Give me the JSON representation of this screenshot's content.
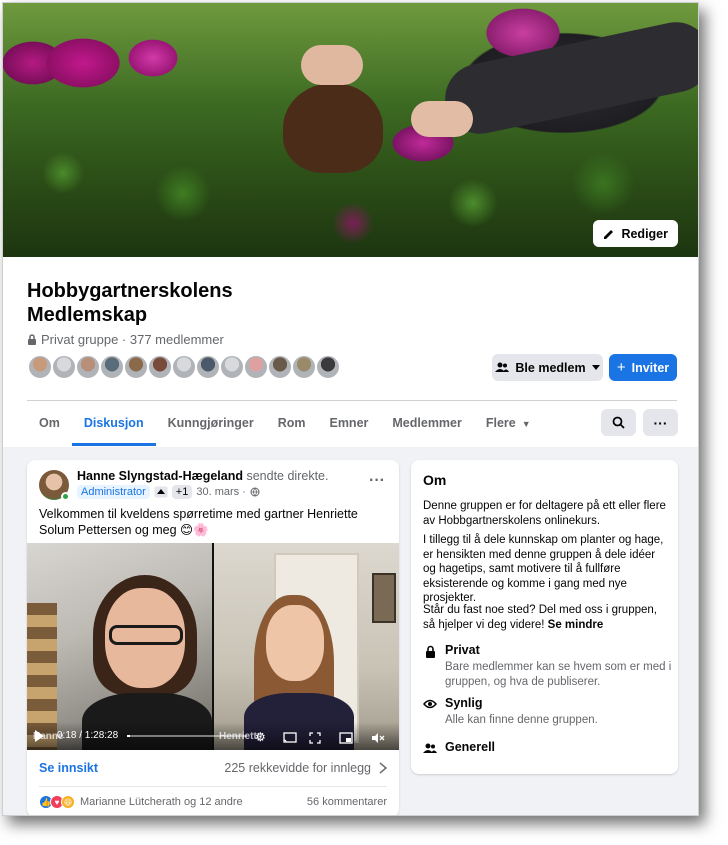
{
  "cover": {
    "edit_label": "Rediger"
  },
  "group": {
    "title": "Hobbygartnerskolens Medlemskap",
    "meta": "Privat gruppe · 377 medlemmer",
    "join_label": "Ble medlem",
    "invite_label": "Inviter",
    "member_avatars": [
      "#c89a7a",
      "#d7d9dc",
      "#b8907a",
      "#5a6b7a",
      "#8a6a4a",
      "#7a4a3a",
      "#d7d9dc",
      "#4a5a6a",
      "#d7d9dc",
      "#e0a0a0",
      "#6a5a4a",
      "#9a8a6a",
      "#3a3a3a"
    ]
  },
  "tabs": [
    {
      "label": "Om",
      "active": false
    },
    {
      "label": "Diskusjon",
      "active": true
    },
    {
      "label": "Kunngjøringer",
      "active": false
    },
    {
      "label": "Rom",
      "active": false
    },
    {
      "label": "Emner",
      "active": false
    },
    {
      "label": "Medlemmer",
      "active": false
    },
    {
      "label": "Flere",
      "active": false
    }
  ],
  "post": {
    "author": "Hanne Slyngstad-Hægeland",
    "action": " sendte direkte.",
    "badge_admin": "Administrator",
    "badge_plus": "+1",
    "date": "30. mars ·",
    "text": "Velkommen til kveldens spørretime med gartner Henriette Solum Pettersen og meg 😊🌸",
    "video": {
      "name_left": "Hanne",
      "name_right": "Henriette",
      "time": "0:18 / 1:28:28",
      "progress": 0.003
    },
    "insight_label": "Se innsikt",
    "reach": "225 rekkevidde for innlegg",
    "reactions_text": "Marianne Lütcherath og 12 andre",
    "comments": "56 kommentarer"
  },
  "about": {
    "title": "Om",
    "p1": "Denne gruppen er for deltagere på ett eller flere av Hobbgartnerskolens onlinekurs.",
    "p2": "I tillegg til å dele kunnskap om planter og hage, er hensikten med denne gruppen å dele idéer og hagetips, samt motivere til å fullføre eksisterende og komme i gang med nye prosjekter.",
    "p3": "Står du fast noe sted? Del med oss i gruppen, så hjelper vi deg videre!",
    "see_less": "Se mindre",
    "items": [
      {
        "title": "Privat",
        "desc": "Bare medlemmer kan se hvem som er med i gruppen, og hva de publiserer.",
        "icon": "lock-icon"
      },
      {
        "title": "Synlig",
        "desc": "Alle kan finne denne gruppen.",
        "icon": "eye-icon"
      },
      {
        "title": "Generell",
        "desc": "",
        "icon": "people-icon"
      }
    ]
  },
  "colors": {
    "accent": "#1b74e4",
    "background": "#f0f2f5",
    "secondary_text": "#65676b"
  }
}
